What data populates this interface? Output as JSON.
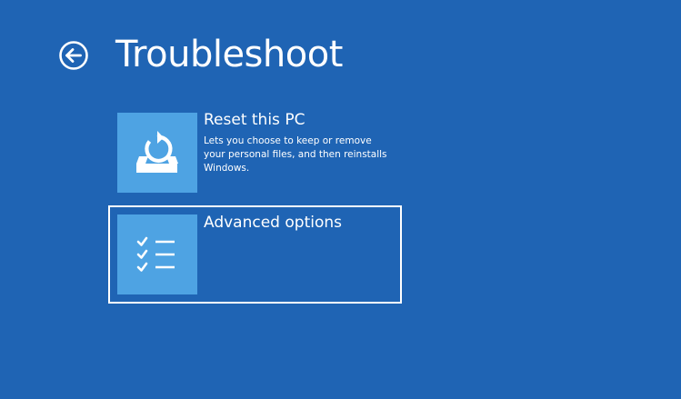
{
  "page": {
    "title": "Troubleshoot",
    "background_color": "#1f64b4",
    "tile_color": "#4ea3e3"
  },
  "back_button": {
    "icon": "back-arrow-icon"
  },
  "options": [
    {
      "title": "Reset this PC",
      "description": "Lets you choose to keep or remove your personal files, and then reinstalls Windows.",
      "icon": "reset-pc-icon",
      "selected": false
    },
    {
      "title": "Advanced options",
      "description": "",
      "icon": "checklist-icon",
      "selected": true
    }
  ]
}
